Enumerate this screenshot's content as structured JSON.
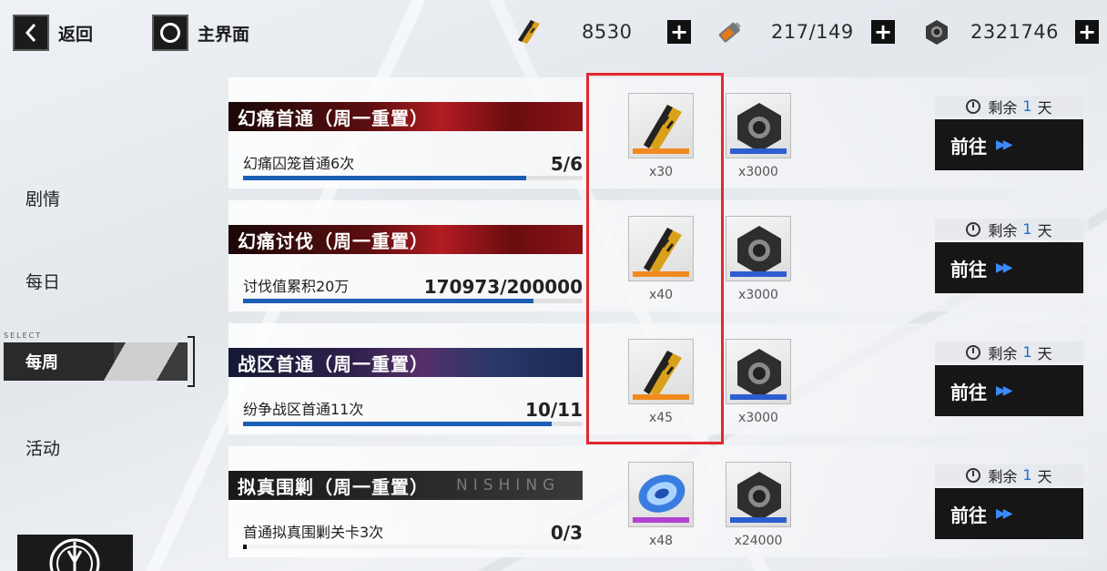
{
  "topbar": {
    "back_label": "返回",
    "home_label": "主界面",
    "resources": [
      {
        "icon": "supply-ticket-icon",
        "value": "8530"
      },
      {
        "icon": "stamina-battery-icon",
        "value": "217/149"
      },
      {
        "icon": "hex-nut-icon",
        "value": "2321746"
      }
    ]
  },
  "nav": {
    "select_tag": "SELECT",
    "items": [
      "剧情",
      "每日",
      "每周",
      "活动"
    ],
    "active_index": 2
  },
  "tasks": [
    {
      "title": "幻痛首通（周一重置）",
      "title_style": "red",
      "description": "幻痛囚笼首通6次",
      "progress_text": "5/6",
      "progress_ratio": 0.833,
      "rewards": [
        {
          "icon": "supply-ticket-icon",
          "qty": "x30",
          "rarity_color": "orange"
        },
        {
          "icon": "hex-nut-icon",
          "qty": "x3000",
          "rarity_color": "blue"
        }
      ],
      "remain_prefix": "剩余",
      "remain_num": "1",
      "remain_unit": "天",
      "goto_label": "前往"
    },
    {
      "title": "幻痛讨伐（周一重置）",
      "title_style": "red",
      "description": "讨伐值累积20万",
      "progress_text": "170973/200000",
      "progress_ratio": 0.855,
      "rewards": [
        {
          "icon": "supply-ticket-icon",
          "qty": "x40",
          "rarity_color": "orange"
        },
        {
          "icon": "hex-nut-icon",
          "qty": "x3000",
          "rarity_color": "blue"
        }
      ],
      "remain_prefix": "剩余",
      "remain_num": "1",
      "remain_unit": "天",
      "goto_label": "前往"
    },
    {
      "title": "战区首通（周一重置）",
      "title_style": "blue",
      "description": "纷争战区首通11次",
      "progress_text": "10/11",
      "progress_ratio": 0.909,
      "rewards": [
        {
          "icon": "supply-ticket-icon",
          "qty": "x45",
          "rarity_color": "orange"
        },
        {
          "icon": "hex-nut-icon",
          "qty": "x3000",
          "rarity_color": "blue"
        }
      ],
      "remain_prefix": "剩余",
      "remain_num": "1",
      "remain_unit": "天",
      "goto_label": "前往"
    },
    {
      "title": "拟真围剿（周一重置）",
      "title_ghost": "NISHING",
      "title_style": "dark",
      "description": "首通拟真围剿关卡3次",
      "progress_text": "0/3",
      "progress_ratio": 0.01,
      "rewards": [
        {
          "icon": "blue-disc-icon",
          "qty": "x48",
          "rarity_color": "purple"
        },
        {
          "icon": "hex-nut-icon",
          "qty": "x24000",
          "rarity_color": "blue"
        }
      ],
      "remain_prefix": "剩余",
      "remain_num": "1",
      "remain_unit": "天",
      "goto_label": "前往"
    }
  ]
}
